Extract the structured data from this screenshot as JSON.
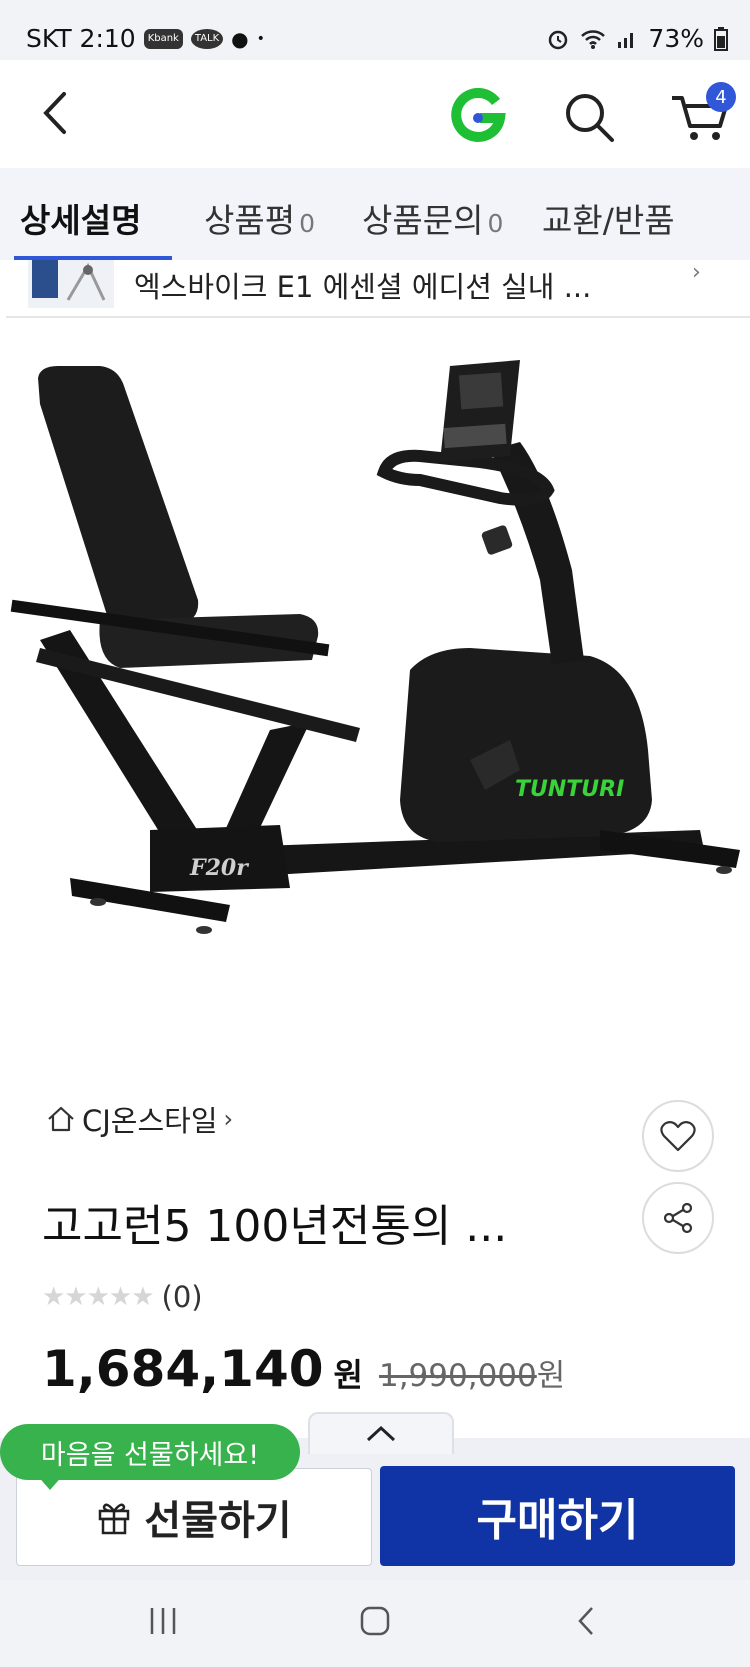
{
  "status_bar": {
    "carrier_time": "SKT 2:10",
    "badges": [
      "Kbank",
      "TALK"
    ],
    "battery": "73%"
  },
  "header": {
    "cart_count": "4",
    "icons": [
      "back-icon",
      "g-logo-icon",
      "search-icon",
      "cart-icon"
    ]
  },
  "tabs": [
    {
      "label": "상세설명",
      "count": ""
    },
    {
      "label": "상품평",
      "count": "0"
    },
    {
      "label": "상품문의",
      "count": "0"
    },
    {
      "label": "교환/반품",
      "count": ""
    }
  ],
  "related": {
    "text": "엑스바이크 E1 에센셜 에디션 실내 ..."
  },
  "product": {
    "brand_model_mark": "F20r",
    "bike_brand": "TUNTURI",
    "store": "CJ온스타일",
    "title": "고고런5 100년전통의 ...",
    "rating_count": "(0)",
    "price": "1,684,140",
    "price_unit": "원",
    "original_price": "1,990,000",
    "original_unit": "원"
  },
  "bottom": {
    "bubble": "마음을 선물하세요!",
    "gift_label": "선물하기",
    "buy_label": "구매하기"
  },
  "colors": {
    "accent_blue": "#1034a6",
    "badge_blue": "#2f57d8",
    "bubble_green": "#37b24d",
    "logo_green": "#1fbf35"
  }
}
